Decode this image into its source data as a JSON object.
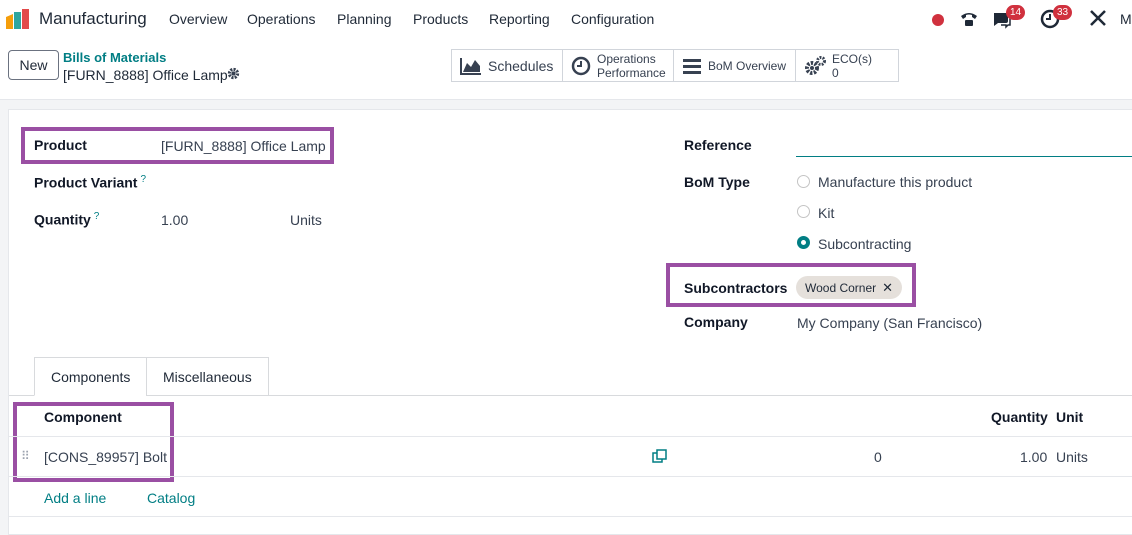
{
  "app": {
    "name": "Manufacturing",
    "logo_icon": "manufacturing-app-icon"
  },
  "menu": [
    "Overview",
    "Operations",
    "Planning",
    "Products",
    "Reporting",
    "Configuration"
  ],
  "systray": {
    "recording_dot_color": "#d0313e",
    "phone_icon": "phone-icon",
    "messages_icon": "chat-icon",
    "messages_count": "14",
    "activity_icon": "clock-icon",
    "activity_count": "33",
    "tools_icon": "tools-icon",
    "user_initial": "M"
  },
  "control": {
    "new_label": "New",
    "breadcrumb_parent": "Bills of Materials",
    "breadcrumb_current": "[FURN_8888] Office Lamp",
    "gear_icon": "gear-icon"
  },
  "smart_buttons": [
    {
      "label": "Schedules",
      "icon": "area-chart-icon"
    },
    {
      "label_line1": "Operations",
      "label_line2": "Performance",
      "icon": "clock-icon"
    },
    {
      "label": "BoM Overview",
      "icon": "bars-icon"
    },
    {
      "label_line1": "ECO(s)",
      "label_line2": "0",
      "icon": "cogs-icon"
    }
  ],
  "form": {
    "product_label": "Product",
    "product_value": "[FURN_8888] Office Lamp",
    "variant_label": "Product Variant",
    "variant_help": "?",
    "quantity_label": "Quantity",
    "quantity_help": "?",
    "quantity_value": "1.00",
    "quantity_uom": "Units",
    "reference_label": "Reference",
    "reference_value": "",
    "bom_type_label": "BoM Type",
    "bom_type_options": [
      "Manufacture this product",
      "Kit",
      "Subcontracting"
    ],
    "bom_type_selected": "Subcontracting",
    "subcontractors_label": "Subcontractors",
    "subcontractor_tag": "Wood Corner",
    "company_label": "Company",
    "company_value": "My Company (San Francisco)"
  },
  "tabs": [
    "Components",
    "Miscellaneous"
  ],
  "components_table": {
    "headers": {
      "component": "Component",
      "quantity": "Quantity",
      "unit": "Unit"
    },
    "rows": [
      {
        "component": "[CONS_89957] Bolt",
        "availability": "0",
        "quantity": "1.00",
        "unit": "Units"
      }
    ],
    "add_line": "Add a line",
    "catalog": "Catalog"
  },
  "colors": {
    "accent": "#017e84",
    "highlight": "#9a4fa3",
    "badge": "#d0313e"
  }
}
